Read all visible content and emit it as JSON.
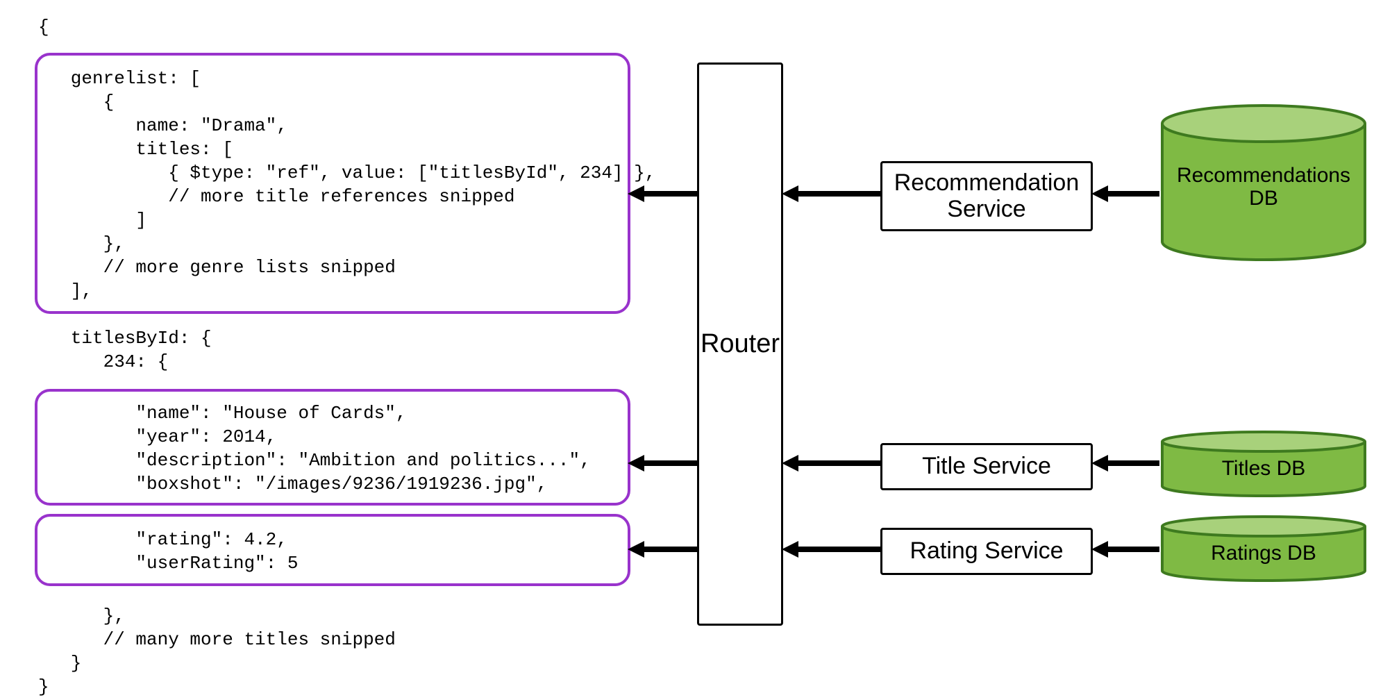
{
  "code_lines": {
    "l0": "{",
    "l1": "   genrelist: [",
    "l2": "      {",
    "l3": "         name: \"Drama\",",
    "l4": "         titles: [",
    "l5": "            { $type: \"ref\", value: [\"titlesById\", 234] },",
    "l6": "            // more title references snipped",
    "l7": "         ]",
    "l8": "      },",
    "l9": "      // more genre lists snipped",
    "l10": "   ],",
    "l11": "",
    "l12": "   titlesById: {",
    "l13": "      234: {",
    "l14": "",
    "l15": "         \"name\": \"House of Cards\",",
    "l16": "         \"year\": 2014,",
    "l17": "         \"description\": \"Ambition and politics...\",",
    "l18": "         \"boxshot\": \"/images/9236/1919236.jpg\",",
    "l19": "",
    "l20": "         \"rating\": 4.2,",
    "l21": "         \"userRating\": 5",
    "l22": "",
    "l23": "      },",
    "l24": "      // many more titles snipped",
    "l25": "   }",
    "l26": "}"
  },
  "router_label": "Router",
  "services": {
    "recommendation": "Recommendation\nService",
    "title": "Title Service",
    "rating": "Rating Service"
  },
  "databases": {
    "recommendations": "Recommendations\nDB",
    "titles": "Titles DB",
    "ratings": "Ratings DB"
  },
  "colors": {
    "purple_border": "#9933cc",
    "cylinder_fill": "#7FBA44",
    "cylinder_top": "#A8D17B",
    "cylinder_stroke": "#3E7A1F"
  }
}
